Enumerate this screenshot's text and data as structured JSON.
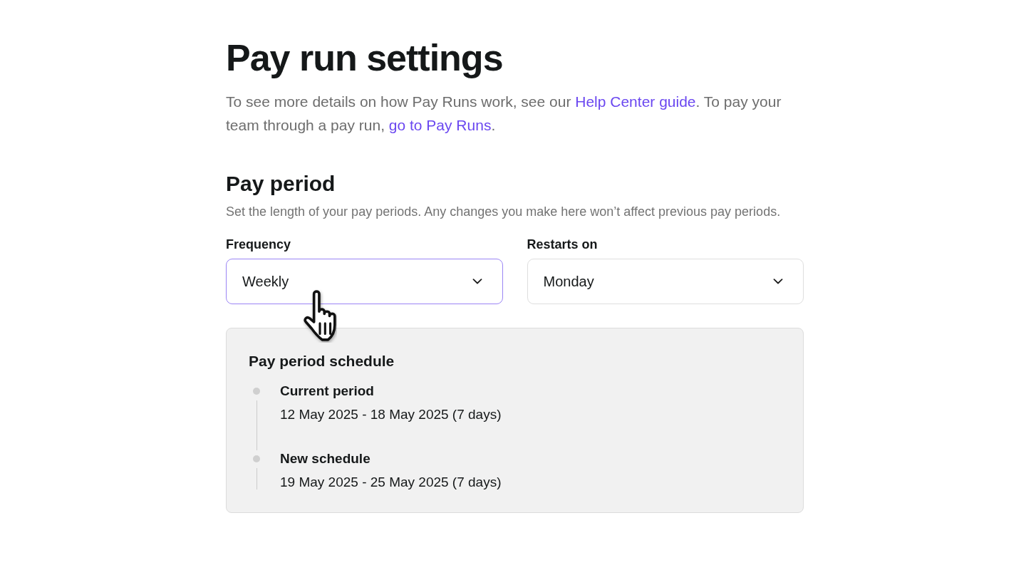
{
  "title": "Pay run settings",
  "intro": [
    {
      "kind": "text",
      "text": "To see more details on how Pay Runs work, see our "
    },
    {
      "kind": "link",
      "text": "Help Center guide"
    },
    {
      "kind": "text",
      "text": ". To pay your team through a pay run, "
    },
    {
      "kind": "link",
      "text": "go to Pay Runs"
    },
    {
      "kind": "text",
      "text": "."
    }
  ],
  "pay_period": {
    "heading": "Pay period",
    "description": "Set the length of your pay periods. Any changes you make here won’t affect previous pay periods.",
    "fields": [
      {
        "label": "Frequency",
        "value": "Weekly",
        "focused": true
      },
      {
        "label": "Restarts on",
        "value": "Monday",
        "focused": false
      }
    ],
    "schedule": {
      "title": "Pay period schedule",
      "items": [
        {
          "name": "Current period",
          "dates": "12 May 2025 - 18 May 2025 (7 days)"
        },
        {
          "name": "New schedule",
          "dates": "19 May 2025 - 25 May 2025 (7 days)"
        }
      ]
    }
  }
}
